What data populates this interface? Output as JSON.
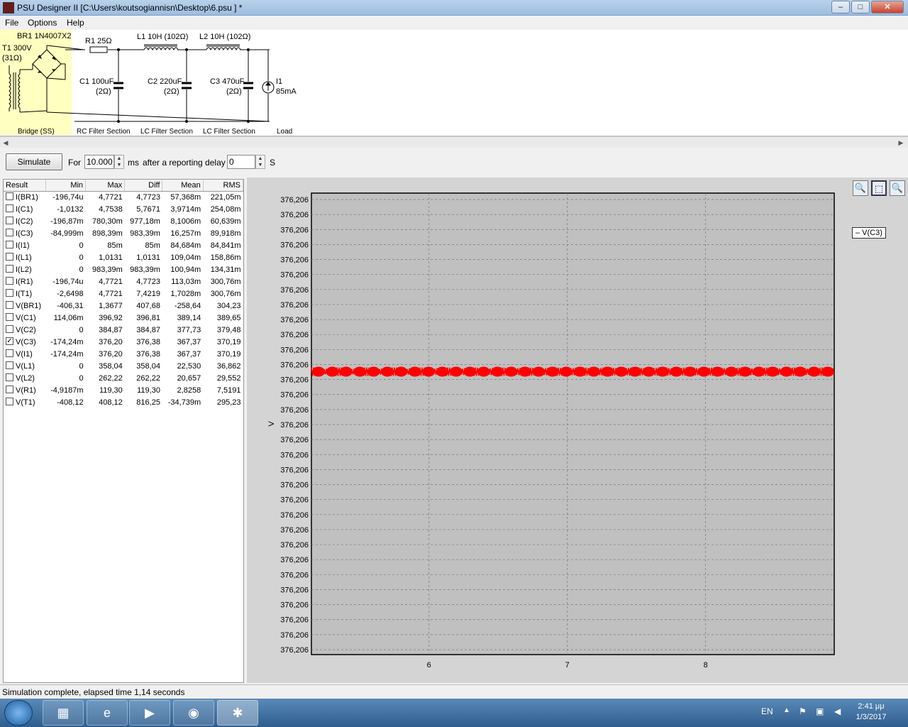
{
  "window": {
    "title": "PSU Designer II  [C:\\Users\\koutsogiannisn\\Desktop\\6.psu ] *",
    "minimize": "–",
    "maximize": "□",
    "close": "✕"
  },
  "menu": [
    "File",
    "Options",
    "Help"
  ],
  "schematic": {
    "t1_label": "T1 300V",
    "t1_res": "(31Ω)",
    "br1_label": "BR1 1N4007X2",
    "r1_label": "R1 25Ω",
    "l1_label": "L1 10H (102Ω)",
    "l2_label": "L2 10H (102Ω)",
    "c1_label": "C1 100uF",
    "c1_esr": "(2Ω)",
    "c2_label": "C2 220uF",
    "c2_esr": "(2Ω)",
    "c3_label": "C3 470uF",
    "c3_esr": "(2Ω)",
    "i1_label": "I1",
    "i1_value": "85mA",
    "sections": [
      "Bridge (SS)",
      "RC Filter Section",
      "LC Filter Section",
      "LC Filter Section",
      "Load"
    ]
  },
  "simulation": {
    "simulate_label": "Simulate",
    "for_label": "For",
    "duration": "10.000",
    "ms_label": "ms",
    "delay_label": "after a reporting delay of",
    "delay": "0",
    "s_label": "S"
  },
  "results": {
    "columns": [
      "Result",
      "Min",
      "Max",
      "Diff",
      "Mean",
      "RMS"
    ],
    "rows": [
      {
        "name": "I(BR1)",
        "checked": false,
        "min": "-196,74u",
        "max": "4,7721",
        "diff": "4,7723",
        "mean": "57,368m",
        "rms": "221,05m"
      },
      {
        "name": "I(C1)",
        "checked": false,
        "min": "-1,0132",
        "max": "4,7538",
        "diff": "5,7671",
        "mean": "3,9714m",
        "rms": "254,08m"
      },
      {
        "name": "I(C2)",
        "checked": false,
        "min": "-196,87m",
        "max": "780,30m",
        "diff": "977,18m",
        "mean": "8,1006m",
        "rms": "60,639m"
      },
      {
        "name": "I(C3)",
        "checked": false,
        "min": "-84,999m",
        "max": "898,39m",
        "diff": "983,39m",
        "mean": "16,257m",
        "rms": "89,918m"
      },
      {
        "name": "I(I1)",
        "checked": false,
        "min": "0",
        "max": "85m",
        "diff": "85m",
        "mean": "84,684m",
        "rms": "84,841m"
      },
      {
        "name": "I(L1)",
        "checked": false,
        "min": "0",
        "max": "1,0131",
        "diff": "1,0131",
        "mean": "109,04m",
        "rms": "158,86m"
      },
      {
        "name": "I(L2)",
        "checked": false,
        "min": "0",
        "max": "983,39m",
        "diff": "983,39m",
        "mean": "100,94m",
        "rms": "134,31m"
      },
      {
        "name": "I(R1)",
        "checked": false,
        "min": "-196,74u",
        "max": "4,7721",
        "diff": "4,7723",
        "mean": "113,03m",
        "rms": "300,76m"
      },
      {
        "name": "I(T1)",
        "checked": false,
        "min": "-2,6498",
        "max": "4,7721",
        "diff": "7,4219",
        "mean": "1,7028m",
        "rms": "300,76m"
      },
      {
        "name": "V(BR1)",
        "checked": false,
        "min": "-406,31",
        "max": "1,3677",
        "diff": "407,68",
        "mean": "-258,64",
        "rms": "304,23"
      },
      {
        "name": "V(C1)",
        "checked": false,
        "min": "114,06m",
        "max": "396,92",
        "diff": "396,81",
        "mean": "389,14",
        "rms": "389,65"
      },
      {
        "name": "V(C2)",
        "checked": false,
        "min": "0",
        "max": "384,87",
        "diff": "384,87",
        "mean": "377,73",
        "rms": "379,48"
      },
      {
        "name": "V(C3)",
        "checked": true,
        "min": "-174,24m",
        "max": "376,20",
        "diff": "376,38",
        "mean": "367,37",
        "rms": "370,19"
      },
      {
        "name": "V(I1)",
        "checked": false,
        "min": "-174,24m",
        "max": "376,20",
        "diff": "376,38",
        "mean": "367,37",
        "rms": "370,19"
      },
      {
        "name": "V(L1)",
        "checked": false,
        "min": "0",
        "max": "358,04",
        "diff": "358,04",
        "mean": "22,530",
        "rms": "36,862"
      },
      {
        "name": "V(L2)",
        "checked": false,
        "min": "0",
        "max": "262,22",
        "diff": "262,22",
        "mean": "20,657",
        "rms": "29,552"
      },
      {
        "name": "V(R1)",
        "checked": false,
        "min": "-4,9187m",
        "max": "119,30",
        "diff": "119,30",
        "mean": "2,8258",
        "rms": "7,5191"
      },
      {
        "name": "V(T1)",
        "checked": false,
        "min": "-408,12",
        "max": "408,12",
        "diff": "816,25",
        "mean": "-34,739m",
        "rms": "295,23"
      }
    ]
  },
  "graph": {
    "tools": [
      "zoom-in-icon",
      "zoom-box-icon",
      "zoom-out-icon"
    ],
    "legend": "– V(C3)",
    "y_label": "V",
    "y_tick_label": "376,206",
    "y_tick_count": 31,
    "x_tick_labels": [
      "6",
      "7",
      "8"
    ],
    "x_range": [
      5.15,
      8.93
    ],
    "x_ticks": [
      6,
      7,
      8
    ],
    "trace_level_fraction": 0.387,
    "trace_color": "#ff0000",
    "plot_bg": "#c0c0c0"
  },
  "status": "Simulation complete, elapsed time 1,14 seconds",
  "taskbar": {
    "lang": "EN",
    "time": "2:41 μμ",
    "date": "1/3/2017"
  }
}
